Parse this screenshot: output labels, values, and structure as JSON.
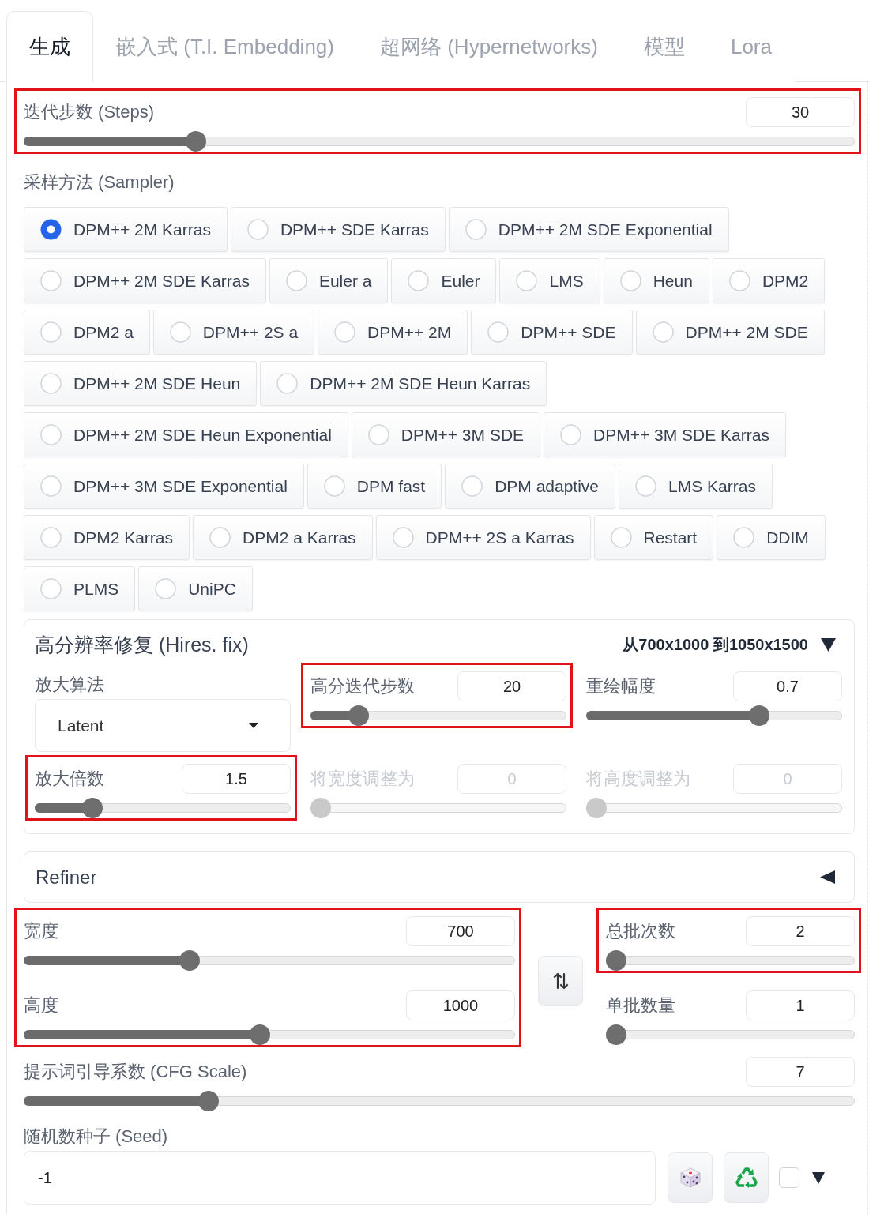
{
  "tabs": [
    {
      "label": "生成",
      "selected": true
    },
    {
      "label": "嵌入式 (T.I. Embedding)",
      "selected": false
    },
    {
      "label": "超网络 (Hypernetworks)",
      "selected": false
    },
    {
      "label": "模型",
      "selected": false
    },
    {
      "label": "Lora",
      "selected": false
    }
  ],
  "steps": {
    "label": "迭代步数 (Steps)",
    "value": "30",
    "level": 0.2,
    "highlighted": true
  },
  "sampler": {
    "label": "采样方法 (Sampler)",
    "options": [
      {
        "label": "DPM++ 2M Karras",
        "selected": true
      },
      {
        "label": "DPM++ SDE Karras",
        "selected": false
      },
      {
        "label": "DPM++ 2M SDE Exponential",
        "selected": false
      },
      {
        "label": "DPM++ 2M SDE Karras",
        "selected": false
      },
      {
        "label": "Euler a",
        "selected": false
      },
      {
        "label": "Euler",
        "selected": false
      },
      {
        "label": "LMS",
        "selected": false
      },
      {
        "label": "Heun",
        "selected": false
      },
      {
        "label": "DPM2",
        "selected": false
      },
      {
        "label": "DPM2 a",
        "selected": false
      },
      {
        "label": "DPM++ 2S a",
        "selected": false
      },
      {
        "label": "DPM++ 2M",
        "selected": false
      },
      {
        "label": "DPM++ SDE",
        "selected": false
      },
      {
        "label": "DPM++ 2M SDE",
        "selected": false
      },
      {
        "label": "DPM++ 2M SDE Heun",
        "selected": false
      },
      {
        "label": "DPM++ 2M SDE Heun Karras",
        "selected": false
      },
      {
        "label": "DPM++ 2M SDE Heun Exponential",
        "selected": false
      },
      {
        "label": "DPM++ 3M SDE",
        "selected": false
      },
      {
        "label": "DPM++ 3M SDE Karras",
        "selected": false
      },
      {
        "label": "DPM++ 3M SDE Exponential",
        "selected": false
      },
      {
        "label": "DPM fast",
        "selected": false
      },
      {
        "label": "DPM adaptive",
        "selected": false
      },
      {
        "label": "LMS Karras",
        "selected": false
      },
      {
        "label": "DPM2 Karras",
        "selected": false
      },
      {
        "label": "DPM2 a Karras",
        "selected": false
      },
      {
        "label": "DPM++ 2S a Karras",
        "selected": false
      },
      {
        "label": "Restart",
        "selected": false
      },
      {
        "label": "DDIM",
        "selected": false
      },
      {
        "label": "PLMS",
        "selected": false
      },
      {
        "label": "UniPC",
        "selected": false
      }
    ]
  },
  "hires_fix": {
    "title": "高分辨率修复 (Hires. fix)",
    "summary": "从700x1000 到1050x1500",
    "expanded": true,
    "controls": [
      {
        "kind": "dropdown",
        "label": "放大算法",
        "value": "Latent",
        "highlighted": false,
        "disabled": false
      },
      {
        "kind": "slider",
        "label": "高分迭代步数",
        "value": "20",
        "level": 0.16,
        "highlighted": true,
        "disabled": false
      },
      {
        "kind": "slider",
        "label": "重绘幅度",
        "value": "0.7",
        "level": 0.69,
        "highlighted": false,
        "disabled": false
      },
      {
        "kind": "slider",
        "label": "放大倍数",
        "value": "1.5",
        "level": 0.2,
        "highlighted": true,
        "disabled": false
      },
      {
        "kind": "slider",
        "label": "将宽度调整为",
        "value": "0",
        "level": 0,
        "highlighted": false,
        "disabled": true
      },
      {
        "kind": "slider",
        "label": "将高度调整为",
        "value": "0",
        "level": 0,
        "highlighted": false,
        "disabled": true
      }
    ]
  },
  "refiner": {
    "title": "Refiner",
    "expanded": false
  },
  "dimensions": {
    "highlighted": true,
    "sliders": [
      {
        "label": "宽度",
        "value": "700",
        "level": 0.33
      },
      {
        "label": "高度",
        "value": "1000",
        "level": 0.48
      }
    ]
  },
  "batch": [
    {
      "label": "总批次数",
      "value": "2",
      "level": 0,
      "highlighted": true
    },
    {
      "label": "单批数量",
      "value": "1",
      "level": 0,
      "highlighted": false
    }
  ],
  "cfg_scale": {
    "label": "提示词引导系数 (CFG Scale)",
    "value": "7",
    "level": 0.215,
    "highlighted": false
  },
  "seed": {
    "label": "随机数种子 (Seed)",
    "value": "-1",
    "checkbox_checked": false
  }
}
